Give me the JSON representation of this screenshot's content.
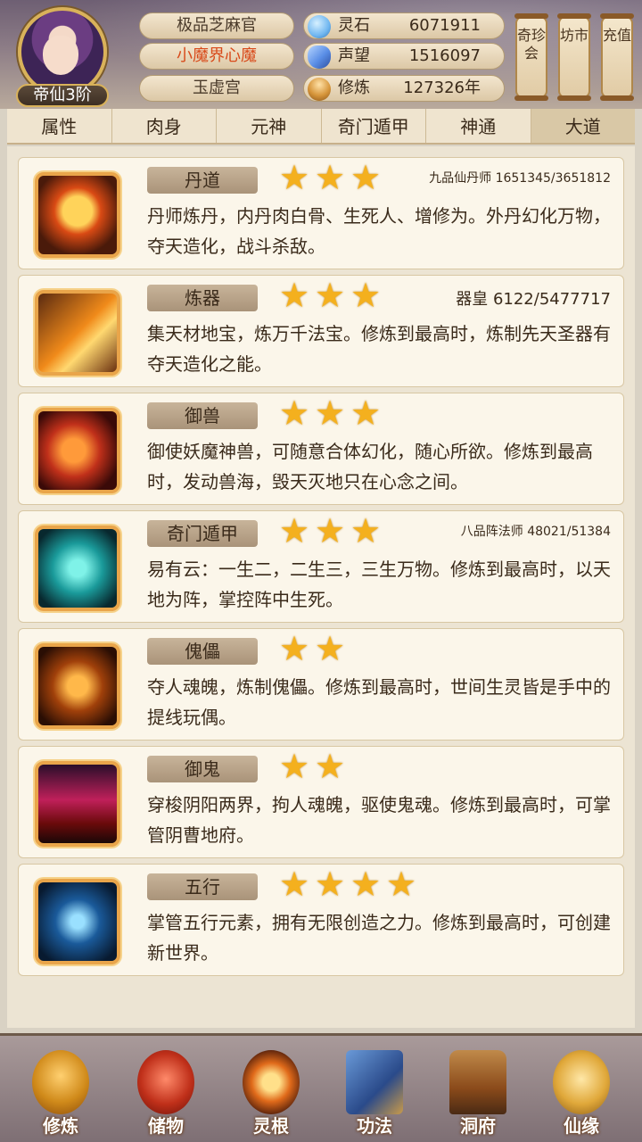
{
  "header": {
    "rank_badge": "帝仙3阶",
    "titles": [
      "极品芝麻官",
      "小魔界心魔",
      "玉虚宫"
    ],
    "stats": [
      {
        "label": "灵石",
        "value": "6071911",
        "icon": "spirit-stone-icon",
        "color": "#6fb6f0"
      },
      {
        "label": "声望",
        "value": "1516097",
        "icon": "reputation-crystal-icon",
        "color": "#5a8ee6"
      },
      {
        "label": "修炼",
        "value": "127326年",
        "icon": "meditation-icon",
        "color": "#d6953a"
      }
    ],
    "side_buttons": [
      "奇珍会",
      "坊市",
      "充值"
    ]
  },
  "tabs": [
    "属性",
    "肉身",
    "元神",
    "奇门遁甲",
    "神通",
    "大道"
  ],
  "active_tab": "大道",
  "cards": [
    {
      "name": "丹道",
      "stars": 3,
      "rank": "九品仙丹师 1651345/3651812",
      "desc": "丹师炼丹，内丹肉白骨、生死人、增修为。外丹幻化万物，夺天造化，战斗杀敌。",
      "icon": "alchemy-pill-icon"
    },
    {
      "name": "炼器",
      "stars": 3,
      "rank": "器皇 6122/5477717",
      "desc": "集天材地宝，炼万千法宝。修炼到最高时，炼制先天圣器有夺天造化之能。",
      "icon": "forging-hammer-icon"
    },
    {
      "name": "御兽",
      "stars": 3,
      "rank": "",
      "desc": "御使妖魔神兽，可随意合体幻化，随心所欲。修炼到最高时，发动兽海，毁天灭地只在心念之间。",
      "icon": "beast-icon"
    },
    {
      "name": "奇门遁甲",
      "stars": 3,
      "rank": "八品阵法师 48021/51384",
      "desc": "易有云：一生二，二生三，三生万物。修炼到最高时，以天地为阵，掌控阵中生死。",
      "icon": "formation-icon"
    },
    {
      "name": "傀儡",
      "stars": 2,
      "rank": "",
      "desc": "夺人魂魄，炼制傀儡。修炼到最高时，世间生灵皆是手中的提线玩偶。",
      "icon": "puppet-icon"
    },
    {
      "name": "御鬼",
      "stars": 2,
      "rank": "",
      "desc": "穿梭阴阳两界，拘人魂魄，驱使鬼魂。修炼到最高时，可掌管阴曹地府。",
      "icon": "ghost-icon"
    },
    {
      "name": "五行",
      "stars": 4,
      "rank": "",
      "desc": "掌管五行元素，拥有无限创造之力。修炼到最高时，可创建新世界。",
      "icon": "five-elements-icon"
    }
  ],
  "bottom_nav": [
    {
      "label": "修炼",
      "icon": "cultivate-icon"
    },
    {
      "label": "储物",
      "icon": "storage-bag-icon"
    },
    {
      "label": "灵根",
      "icon": "spirit-root-icon"
    },
    {
      "label": "功法",
      "icon": "technique-book-icon"
    },
    {
      "label": "洞府",
      "icon": "cave-palace-icon"
    },
    {
      "label": "仙缘",
      "icon": "fortune-gourd-icon"
    }
  ]
}
